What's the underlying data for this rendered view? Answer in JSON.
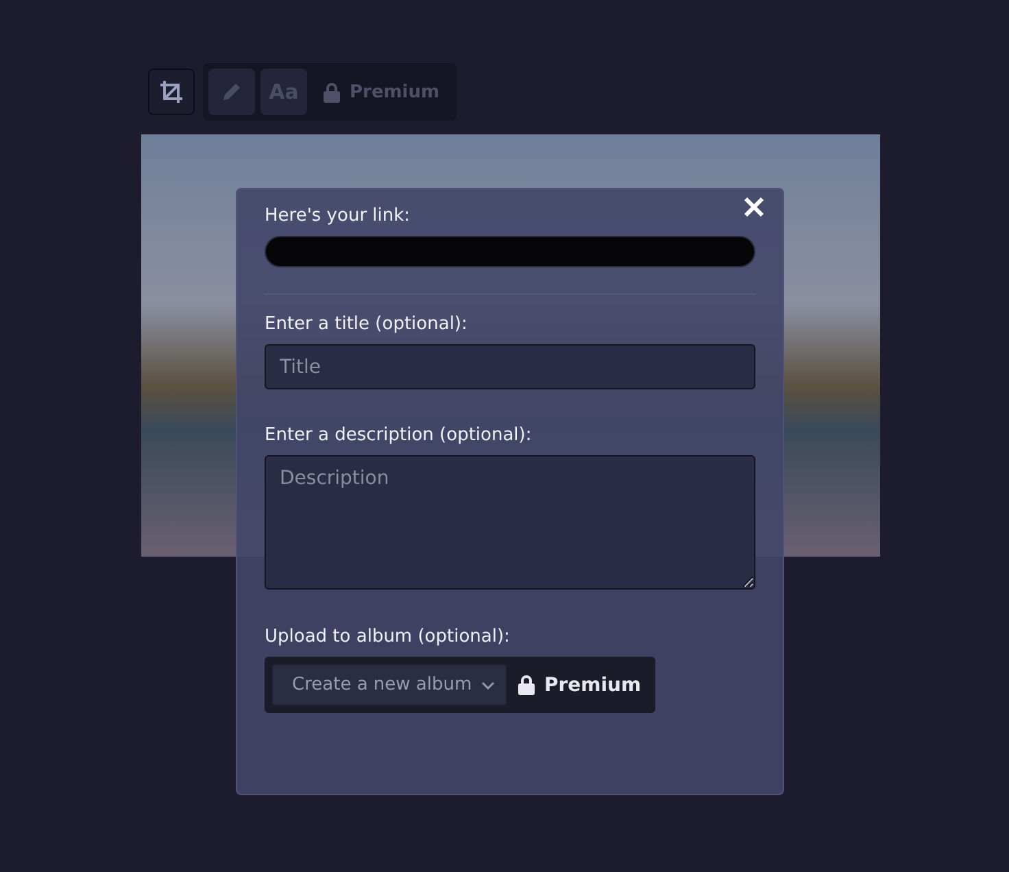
{
  "toolbar": {
    "tools": [
      {
        "kind": "crop",
        "selected": true
      },
      {
        "kind": "pencil",
        "selected": false
      },
      {
        "kind": "text",
        "label": "Aa",
        "selected": false
      }
    ],
    "premium_label": "Premium"
  },
  "share_dialog": {
    "link_label": "Here's your link:",
    "title_label": "Enter a title (optional):",
    "title_placeholder": "Title",
    "description_label": "Enter a description (optional):",
    "description_placeholder": "Description",
    "album_label": "Upload to album (optional):",
    "album_select": "Create a new album",
    "album_premium_label": "Premium"
  }
}
